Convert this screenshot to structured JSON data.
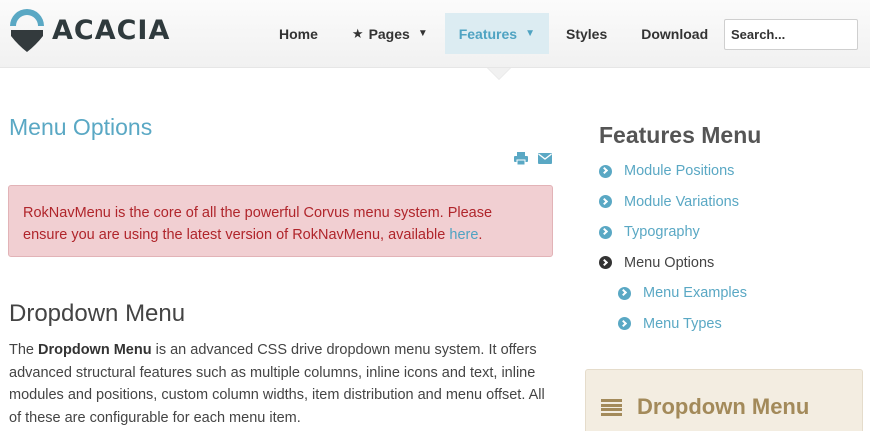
{
  "brand": {
    "name": "ACACIA"
  },
  "nav": {
    "items": [
      {
        "label": "Home"
      },
      {
        "label": "Pages"
      },
      {
        "label": "Features"
      },
      {
        "label": "Styles"
      },
      {
        "label": "Download"
      }
    ],
    "active": "Features"
  },
  "search": {
    "placeholder": "Search..."
  },
  "main": {
    "page_title": "Menu Options",
    "alert": {
      "text": "RokNavMenu is the core of all the powerful Corvus menu system. Please ensure you are using the latest version of RokNavMenu, available ",
      "link": "here",
      "end": "."
    },
    "section": {
      "title": "Dropdown Menu",
      "intro": "The ",
      "bold": "Dropdown Menu",
      "body": " is an advanced CSS drive dropdown menu system. It offers advanced structural features such as multiple columns, inline icons and text, inline modules and positions, custom column widths, item distribution and menu offset. All of these are configurable for each menu item."
    }
  },
  "sidebar": {
    "title": "Features Menu",
    "items": [
      {
        "label": "Module Positions"
      },
      {
        "label": "Module Variations"
      },
      {
        "label": "Typography"
      },
      {
        "label": "Menu Options"
      },
      {
        "label": "Menu Examples"
      },
      {
        "label": "Menu Types"
      }
    ],
    "box_title": "Dropdown Menu"
  },
  "colors": {
    "accent": "#5aa8c4",
    "alert_bg": "#f1cfd2",
    "alert_text": "#b0252b",
    "box_accent": "#a38a5a"
  }
}
